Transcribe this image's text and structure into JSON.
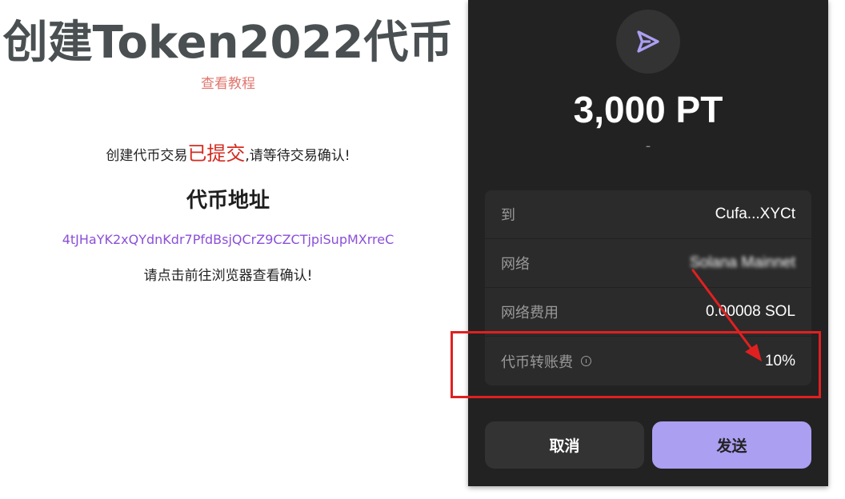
{
  "left": {
    "title": "创建Token2022代币",
    "tutorial_link": "查看教程",
    "status_prefix": "创建代币交易",
    "status_highlight": "已提交",
    "status_suffix": ",请等待交易确认!",
    "address_heading": "代币地址",
    "address_value": "4tJHaYK2xQYdnKdr7PfdBsjQCrZ9CZCTjpiSupMXrreC",
    "hint": "请点击前往浏览器查看确认!"
  },
  "wallet": {
    "send_icon": "send-icon",
    "amount": "3,000 PT",
    "amount_sub": "-",
    "rows": [
      {
        "label": "到",
        "value": "Cufa...XYCt"
      },
      {
        "label": "网络",
        "value": "Solana Mainnet"
      },
      {
        "label": "网络费用",
        "value": "0.00008 SOL"
      },
      {
        "label": "代币转账费",
        "value": "10%"
      }
    ],
    "cancel_label": "取消",
    "send_label": "发送"
  },
  "colors": {
    "accent_purple": "#ab9ff2",
    "annotation_red": "#e02020",
    "link_red": "#e0766e",
    "address_purple": "#8b4fd8"
  }
}
